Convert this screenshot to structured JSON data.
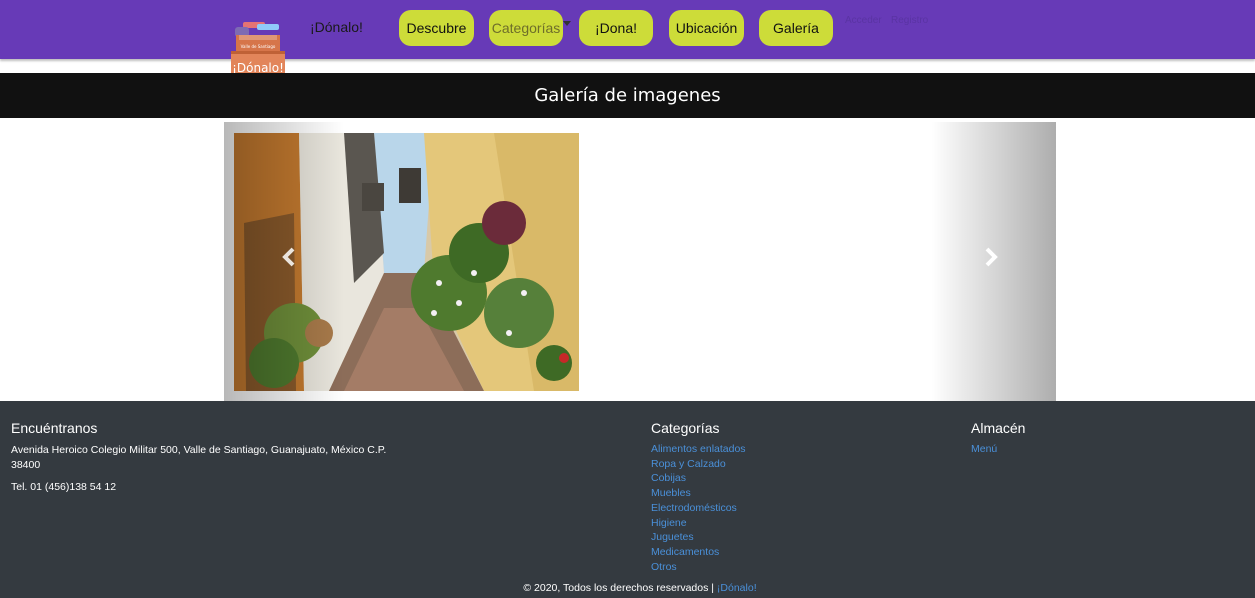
{
  "navbar": {
    "logo_top_text": "Valle de Santiago",
    "logo_text": "¡Dónalo!",
    "brand": "¡Dónalo!",
    "items": [
      {
        "label": "Descubre",
        "active": false
      },
      {
        "label": "Categorías",
        "active": true,
        "dropdown": true
      },
      {
        "label": "¡Dona!",
        "active": false
      },
      {
        "label": "Ubicación",
        "active": false
      },
      {
        "label": "Galería",
        "active": false
      }
    ],
    "login": "Acceder",
    "register": "Registro",
    "icons": {
      "caret": "caret-down-icon"
    }
  },
  "gallery": {
    "title": "Galería de imagenes",
    "prev_icon": "chevron-left-icon",
    "next_icon": "chevron-right-icon"
  },
  "footer": {
    "find_us": {
      "title": "Encuéntranos",
      "address": "Avenida Heroico Colegio Militar 500, Valle de Santiago, Guanajuato, México C.P. 38400",
      "phone": "Tel. 01 (456)138 54 12"
    },
    "categories": {
      "title": "Categorías",
      "items": [
        "Alimentos enlatados",
        "Ropa y Calzado",
        "Cobijas",
        "Muebles",
        "Electrodomésticos",
        "Higiene",
        "Juguetes",
        "Medicamentos",
        "Otros"
      ]
    },
    "warehouse": {
      "title": "Almacén",
      "items": [
        "Menú"
      ]
    },
    "copyright": "© 2020, Todos los derechos reservados |",
    "copyright_link": "¡Dónalo!"
  },
  "colors": {
    "navbar": "#673ab7",
    "pill": "#cddc39",
    "gallery_bar": "#111111",
    "footer": "#343a40",
    "link": "#4a90d9"
  }
}
